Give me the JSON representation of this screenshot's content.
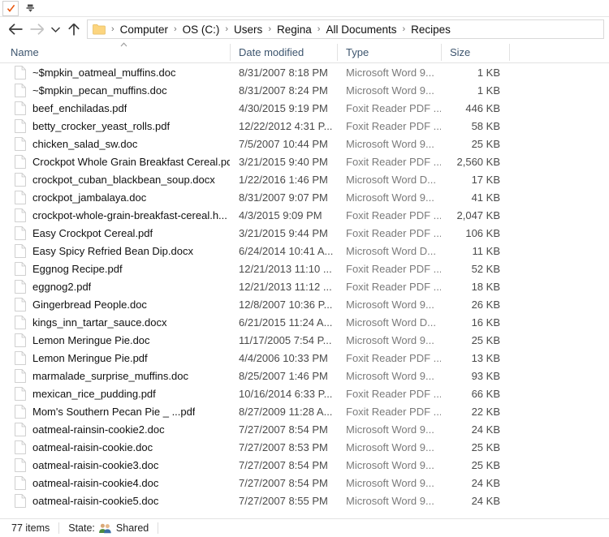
{
  "window": {
    "quick_access_toolbar": {
      "checkmark_button": "check-icon",
      "dropdown_button": "customize-toolbar-icon"
    }
  },
  "navigation": {
    "back_label": "Back",
    "forward_label": "Forward",
    "recent_label": "Recent locations",
    "up_label": "Up",
    "address": {
      "folder_icon": "folder-icon",
      "separator": "›",
      "crumbs": [
        "Computer",
        "OS (C:)",
        "Users",
        "Regina",
        "All Documents",
        "Recipes"
      ]
    }
  },
  "columns": {
    "name": "Name",
    "date_modified": "Date modified",
    "type": "Type",
    "size": "Size",
    "sort_column": "Name",
    "sort_direction": "ascending"
  },
  "files": [
    {
      "name": "~$mpkin_oatmeal_muffins.doc",
      "date": "8/31/2007 8:18 PM",
      "type": "Microsoft Word 9...",
      "size": "1 KB"
    },
    {
      "name": "~$mpkin_pecan_muffins.doc",
      "date": "8/31/2007 8:24 PM",
      "type": "Microsoft Word 9...",
      "size": "1 KB"
    },
    {
      "name": "beef_enchiladas.pdf",
      "date": "4/30/2015 9:19 PM",
      "type": "Foxit Reader PDF ...",
      "size": "446 KB"
    },
    {
      "name": "betty_crocker_yeast_rolls.pdf",
      "date": "12/22/2012 4:31 P...",
      "type": "Foxit Reader PDF ...",
      "size": "58 KB"
    },
    {
      "name": "chicken_salad_sw.doc",
      "date": "7/5/2007 10:44 PM",
      "type": "Microsoft Word 9...",
      "size": "25 KB"
    },
    {
      "name": "Crockpot Whole Grain Breakfast Cereal.pdf",
      "date": "3/21/2015 9:40 PM",
      "type": "Foxit Reader PDF ...",
      "size": "2,560 KB"
    },
    {
      "name": "crockpot_cuban_blackbean_soup.docx",
      "date": "1/22/2016 1:46 PM",
      "type": "Microsoft Word D...",
      "size": "17 KB"
    },
    {
      "name": "crockpot_jambalaya.doc",
      "date": "8/31/2007 9:07 PM",
      "type": "Microsoft Word 9...",
      "size": "41 KB"
    },
    {
      "name": "crockpot-whole-grain-breakfast-cereal.h...",
      "date": "4/3/2015 9:09 PM",
      "type": "Foxit Reader PDF ...",
      "size": "2,047 KB"
    },
    {
      "name": "Easy Crockpot Cereal.pdf",
      "date": "3/21/2015 9:44 PM",
      "type": "Foxit Reader PDF ...",
      "size": "106 KB"
    },
    {
      "name": "Easy Spicy Refried Bean Dip.docx",
      "date": "6/24/2014 10:41 A...",
      "type": "Microsoft Word D...",
      "size": "11 KB"
    },
    {
      "name": "Eggnog Recipe.pdf",
      "date": "12/21/2013 11:10 ...",
      "type": "Foxit Reader PDF ...",
      "size": "52 KB"
    },
    {
      "name": "eggnog2.pdf",
      "date": "12/21/2013 11:12 ...",
      "type": "Foxit Reader PDF ...",
      "size": "18 KB"
    },
    {
      "name": "Gingerbread People.doc",
      "date": "12/8/2007 10:36 P...",
      "type": "Microsoft Word 9...",
      "size": "26 KB"
    },
    {
      "name": "kings_inn_tartar_sauce.docx",
      "date": "6/21/2015 11:24 A...",
      "type": "Microsoft Word D...",
      "size": "16 KB"
    },
    {
      "name": "Lemon Meringue Pie.doc",
      "date": "11/17/2005 7:54 P...",
      "type": "Microsoft Word 9...",
      "size": "25 KB"
    },
    {
      "name": "Lemon Meringue Pie.pdf",
      "date": "4/4/2006 10:33 PM",
      "type": "Foxit Reader PDF ...",
      "size": "13 KB"
    },
    {
      "name": "marmalade_surprise_muffins.doc",
      "date": "8/25/2007 1:46 PM",
      "type": "Microsoft Word 9...",
      "size": "93 KB"
    },
    {
      "name": "mexican_rice_pudding.pdf",
      "date": "10/16/2014 6:33 P...",
      "type": "Foxit Reader PDF ...",
      "size": "66 KB"
    },
    {
      "name": "Mom's Southern Pecan Pie _ ...pdf",
      "date": "8/27/2009 11:28 A...",
      "type": "Foxit Reader PDF ...",
      "size": "22 KB"
    },
    {
      "name": "oatmeal-rainsin-cookie2.doc",
      "date": "7/27/2007 8:54 PM",
      "type": "Microsoft Word 9...",
      "size": "24 KB"
    },
    {
      "name": "oatmeal-raisin-cookie.doc",
      "date": "7/27/2007 8:53 PM",
      "type": "Microsoft Word 9...",
      "size": "25 KB"
    },
    {
      "name": "oatmeal-raisin-cookie3.doc",
      "date": "7/27/2007 8:54 PM",
      "type": "Microsoft Word 9...",
      "size": "25 KB"
    },
    {
      "name": "oatmeal-raisin-cookie4.doc",
      "date": "7/27/2007 8:54 PM",
      "type": "Microsoft Word 9...",
      "size": "24 KB"
    },
    {
      "name": "oatmeal-raisin-cookie5.doc",
      "date": "7/27/2007 8:55 PM",
      "type": "Microsoft Word 9...",
      "size": "24 KB"
    }
  ],
  "status_bar": {
    "item_count": "77 items",
    "state_label": "State:",
    "state_value": "Shared",
    "state_icon": "shared-people-icon"
  },
  "colors": {
    "folder": "#fcd57f",
    "header_text": "#3d556e",
    "check_accent": "#e8560d",
    "shared_green": "#4c8c3f",
    "shared_blue": "#3a6ea5"
  }
}
